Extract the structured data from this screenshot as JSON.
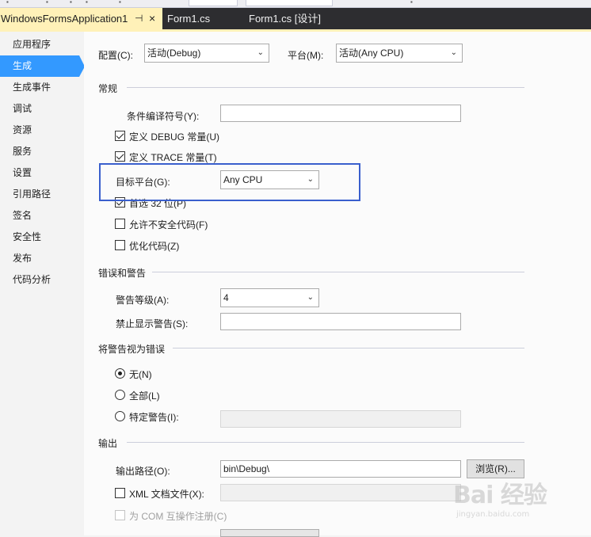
{
  "tabs": [
    {
      "label": "WindowsFormsApplication1",
      "pin": "⊣",
      "close": "×",
      "active": true
    },
    {
      "label": "Form1.cs",
      "active": false
    },
    {
      "label": "Form1.cs [设计]",
      "active": false
    }
  ],
  "sidebar": {
    "items": [
      {
        "label": "应用程序"
      },
      {
        "label": "生成",
        "active": true
      },
      {
        "label": "生成事件"
      },
      {
        "label": "调试"
      },
      {
        "label": "资源"
      },
      {
        "label": "服务"
      },
      {
        "label": "设置"
      },
      {
        "label": "引用路径"
      },
      {
        "label": "签名"
      },
      {
        "label": "安全性"
      },
      {
        "label": "发布"
      },
      {
        "label": "代码分析"
      }
    ]
  },
  "config": {
    "config_label": "配置(C):",
    "config_value": "活动(Debug)",
    "platform_label": "平台(M):",
    "platform_value": "活动(Any CPU)"
  },
  "general": {
    "header": "常规",
    "cond_symbols_label": "条件编译符号(Y):",
    "cond_symbols_value": "",
    "define_debug": {
      "label": "定义 DEBUG 常量(U)",
      "checked": true
    },
    "define_trace": {
      "label": "定义 TRACE 常量(T)",
      "checked": true
    },
    "target_platform_label": "目标平台(G):",
    "target_platform_value": "Any CPU",
    "prefer32": {
      "label": "首选 32 位(P)",
      "checked": true
    },
    "allow_unsafe": {
      "label": "允许不安全代码(F)",
      "checked": false
    },
    "optimize": {
      "label": "优化代码(Z)",
      "checked": false
    }
  },
  "errors": {
    "header": "错误和警告",
    "warning_level_label": "警告等级(A):",
    "warning_level_value": "4",
    "suppress_label": "禁止显示警告(S):",
    "suppress_value": ""
  },
  "treat_warnings": {
    "header": "将警告视为错误",
    "none": {
      "label": "无(N)",
      "checked": true
    },
    "all": {
      "label": "全部(L)",
      "checked": false
    },
    "specific": {
      "label": "特定警告(I):",
      "checked": false
    },
    "specific_value": ""
  },
  "output": {
    "header": "输出",
    "path_label": "输出路径(O):",
    "path_value": "bin\\Debug\\",
    "browse_label": "浏览(R)...",
    "xml_doc": {
      "label": "XML 文档文件(X):",
      "checked": false
    },
    "xml_doc_value": "",
    "com_interop": {
      "label": "为 COM 互操作注册(C)",
      "checked": false
    }
  },
  "watermark": {
    "text": "Bai 经验",
    "sub": "jingyan.baidu.com"
  },
  "colors": {
    "accent": "#3399ff",
    "tab_active": "#fff1b8",
    "tab_bar": "#2d2d30",
    "highlight_box": "#3a5fcd"
  }
}
